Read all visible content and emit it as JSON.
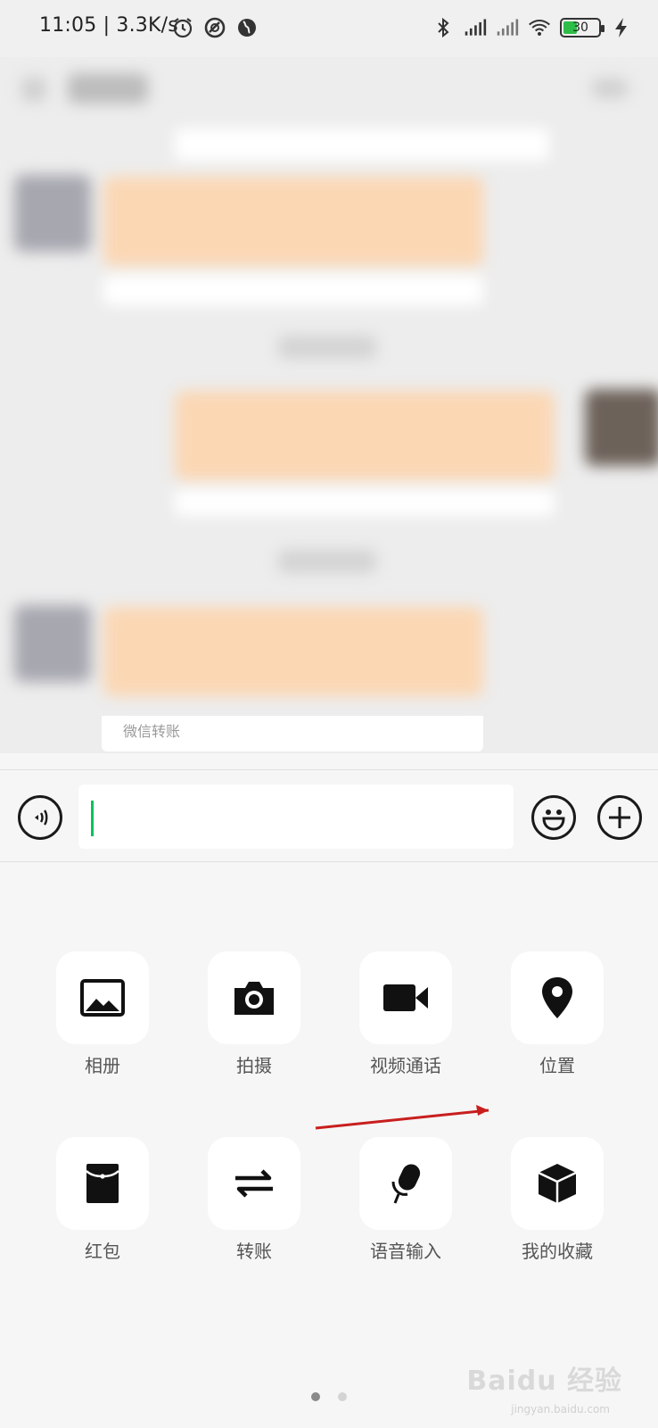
{
  "status_bar": {
    "time": "11:05",
    "speed": "| 3.3K/s",
    "battery_level": "30",
    "icons": [
      "alarm-icon",
      "no-disturb-icon",
      "globe-icon",
      "bluetooth-icon",
      "signal-icon",
      "signal-icon",
      "wifi-icon",
      "battery-icon",
      "charging-icon"
    ]
  },
  "chat": {
    "partial_card_text": "微信转账"
  },
  "input_bar": {
    "value": "",
    "icons": [
      "voice-icon",
      "emoji-icon",
      "plus-icon"
    ],
    "accent_color": "#07c160"
  },
  "panel": {
    "items": [
      {
        "label": "相册",
        "icon": "image-icon"
      },
      {
        "label": "拍摄",
        "icon": "camera-icon"
      },
      {
        "label": "视频通话",
        "icon": "video-call-icon"
      },
      {
        "label": "位置",
        "icon": "location-pin-icon"
      },
      {
        "label": "红包",
        "icon": "red-packet-icon"
      },
      {
        "label": "转账",
        "icon": "transfer-icon"
      },
      {
        "label": "语音输入",
        "icon": "microphone-icon"
      },
      {
        "label": "我的收藏",
        "icon": "favorites-cube-icon"
      }
    ],
    "pages": 2,
    "current_page": 1
  },
  "annotation": {
    "type": "red-arrow",
    "color": "#cc1f1f",
    "points_to": "位置"
  },
  "watermark": {
    "text": "Baidu 经验",
    "sub": "jingyan.baidu.com"
  }
}
